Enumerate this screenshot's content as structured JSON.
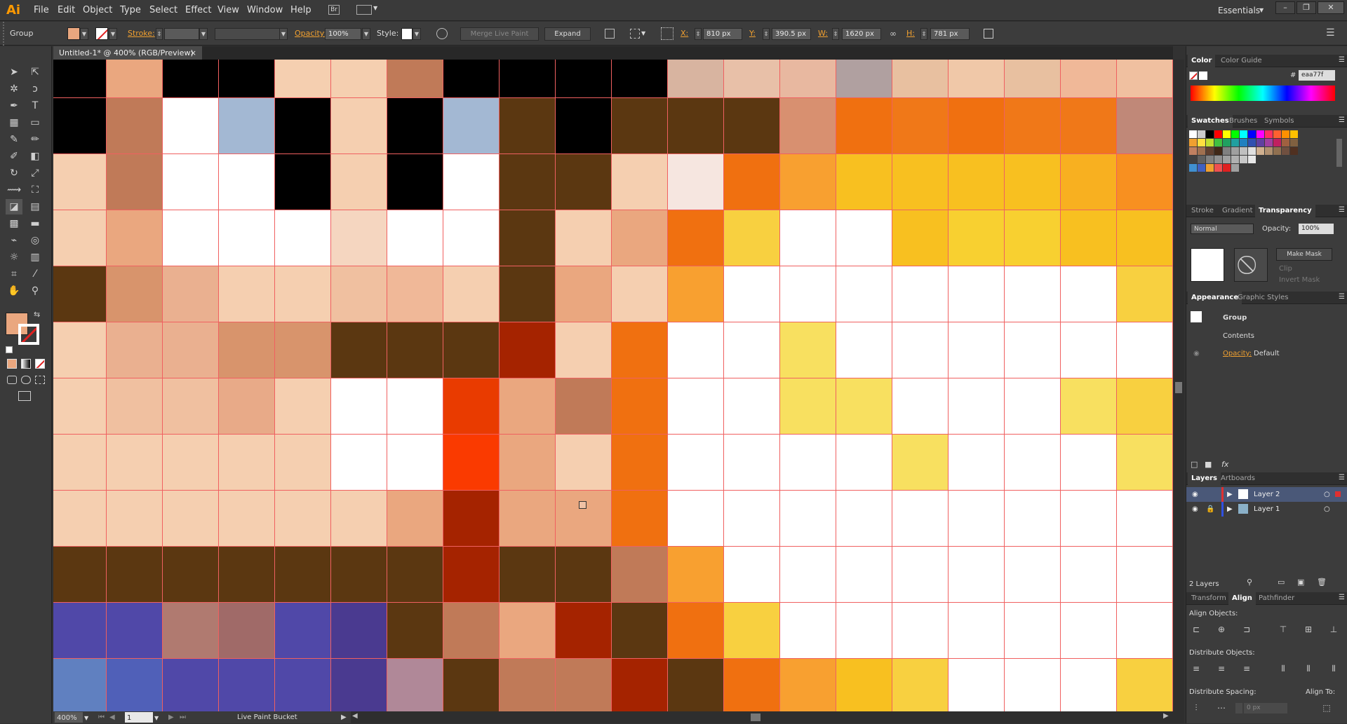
{
  "app": {
    "logo": "Ai",
    "workspace": "Essentials"
  },
  "menu": [
    "File",
    "Edit",
    "Object",
    "Type",
    "Select",
    "Effect",
    "View",
    "Window",
    "Help"
  ],
  "window_controls": [
    "–",
    "❐",
    "✕"
  ],
  "control_bar": {
    "selection_type": "Group",
    "stroke_label": "Stroke:",
    "opacity_label": "Opacity:",
    "opacity_value": "100%",
    "style_label": "Style:",
    "merge_live_paint": "Merge Live Paint",
    "expand": "Expand",
    "x_label": "X:",
    "x_value": "810 px",
    "y_label": "Y:",
    "y_value": "390.5 px",
    "w_label": "W:",
    "w_value": "1620 px",
    "h_label": "H:",
    "h_value": "781 px"
  },
  "document": {
    "tab_title": "Untitled-1* @ 400% (RGB/Preview)",
    "close": "×"
  },
  "status": {
    "zoom": "400%",
    "artboard": "1",
    "tool": "Live Paint Bucket"
  },
  "colors": {
    "fill": "#eaa77f",
    "accent_orange": "#f0a030"
  },
  "panels": {
    "color": {
      "tabs": [
        "Color",
        "Color Guide"
      ],
      "hex": "eaa77f"
    },
    "swatches": {
      "tabs": [
        "Swatches",
        "Brushes",
        "Symbols"
      ]
    },
    "transparency": {
      "tabs": [
        "Stroke",
        "Gradient",
        "Transparency"
      ],
      "blend_mode": "Normal",
      "opacity_label": "Opacity:",
      "opacity_value": "100%",
      "make_mask": "Make Mask",
      "clip": "Clip",
      "invert_mask": "Invert Mask"
    },
    "appearance": {
      "tabs": [
        "Appearance",
        "Graphic Styles"
      ],
      "group": "Group",
      "contents": "Contents",
      "opacity_label": "Opacity:",
      "opacity_value": "Default"
    },
    "layers": {
      "tabs": [
        "Layers",
        "Artboards"
      ],
      "items": [
        "Layer 2",
        "Layer 1"
      ],
      "count": "2 Layers"
    },
    "align": {
      "tabs": [
        "Transform",
        "Align",
        "Pathfinder"
      ],
      "align_objects": "Align Objects:",
      "distribute_objects": "Distribute Objects:",
      "distribute_spacing": "Distribute Spacing:",
      "align_to": "Align To:",
      "spacing_value": "0 px"
    }
  },
  "canvas_rows": [
    [
      "#000000",
      "#eaa77f",
      "#000000",
      "#000000",
      "#f5cfb0",
      "#f5cfb0",
      "#c07a58",
      "#000000",
      "#000000",
      "#000000",
      "#000000",
      "#d8b4a0",
      "#e8c0a8",
      "#e8b8a0",
      "#b0a0a0",
      "#e8c0a0",
      "#f0c8a8",
      "#e8c0a0",
      "#f0b898",
      "#f0c0a0"
    ],
    [
      "#000000",
      "#c07a58",
      "#ffffff",
      "#a3b8d3",
      "#000000",
      "#f5cfb0",
      "#000000",
      "#a3b8d3",
      "#5b3711",
      "#000000",
      "#5b3711",
      "#5b3711",
      "#5b3711",
      "#d89070",
      "#f07010",
      "#f07818",
      "#f07010",
      "#f07818",
      "#f07818",
      "#c08878"
    ],
    [
      "#f5cfb0",
      "#c07a58",
      "#ffffff",
      "#ffffff",
      "#000000",
      "#f5cfb0",
      "#000000",
      "#ffffff",
      "#5b3711",
      "#5b3711",
      "#f5cfb0",
      "#f6e6e0",
      "#f07010",
      "#f8a030",
      "#f8c020",
      "#f8c020",
      "#f8c020",
      "#f8c020",
      "#f8b020",
      "#f89020"
    ],
    [
      "#f5cfb0",
      "#eaa77f",
      "#ffffff",
      "#ffffff",
      "#ffffff",
      "#f5d6c0",
      "#ffffff",
      "#ffffff",
      "#5b3711",
      "#f5cfb0",
      "#eaa77f",
      "#f07010",
      "#f8d040",
      "#ffffff",
      "#ffffff",
      "#f8c020",
      "#f8d030",
      "#f8d030",
      "#f8c020",
      "#f8c020"
    ],
    [
      "#5b3711",
      "#d8946c",
      "#eab090",
      "#f5cfb0",
      "#f5cfb0",
      "#f0c0a0",
      "#f0b898",
      "#f5cfb0",
      "#5b3711",
      "#eaa77f",
      "#f5cfb0",
      "#f8a030",
      "#ffffff",
      "#ffffff",
      "#ffffff",
      "#ffffff",
      "#ffffff",
      "#ffffff",
      "#ffffff",
      "#f8d040"
    ],
    [
      "#f5cfb0",
      "#eab090",
      "#eab090",
      "#d8946c",
      "#d8946c",
      "#5b3711",
      "#5b3711",
      "#5b3711",
      "#a52300",
      "#f5cfb0",
      "#f07010",
      "#ffffff",
      "#ffffff",
      "#f8e060",
      "#ffffff",
      "#ffffff",
      "#ffffff",
      "#ffffff",
      "#ffffff",
      "#ffffff"
    ],
    [
      "#f5cfb0",
      "#f0c0a0",
      "#f0c0a0",
      "#e8aa88",
      "#f5cfb0",
      "#ffffff",
      "#ffffff",
      "#e93b00",
      "#eaa77f",
      "#c07a58",
      "#f07010",
      "#ffffff",
      "#ffffff",
      "#f8e060",
      "#f8e060",
      "#ffffff",
      "#ffffff",
      "#ffffff",
      "#f8e060",
      "#f8d040"
    ],
    [
      "#f5cfb0",
      "#f5cfb0",
      "#f5cfb0",
      "#f5cfb0",
      "#f5cfb0",
      "#ffffff",
      "#ffffff",
      "#fa3a00",
      "#eaa77f",
      "#f5cfb0",
      "#f07010",
      "#ffffff",
      "#ffffff",
      "#ffffff",
      "#ffffff",
      "#f8e060",
      "#ffffff",
      "#ffffff",
      "#ffffff",
      "#f8e060"
    ],
    [
      "#f5cfb0",
      "#f5cfb0",
      "#f5cfb0",
      "#f5cfb0",
      "#f5cfb0",
      "#f5cfb0",
      "#eaa77f",
      "#a52300",
      "#eaa77f",
      "#eaa77f",
      "#f07010",
      "#ffffff",
      "#ffffff",
      "#ffffff",
      "#ffffff",
      "#ffffff",
      "#ffffff",
      "#ffffff",
      "#ffffff",
      "#ffffff"
    ],
    [
      "#5b3711",
      "#5b3711",
      "#5b3711",
      "#5b3711",
      "#5b3711",
      "#5b3711",
      "#5b3711",
      "#a52300",
      "#5b3711",
      "#5b3711",
      "#c07a58",
      "#f8a030",
      "#ffffff",
      "#ffffff",
      "#ffffff",
      "#ffffff",
      "#ffffff",
      "#ffffff",
      "#ffffff",
      "#ffffff"
    ],
    [
      "#5048a8",
      "#5048a8",
      "#b07a70",
      "#a06a68",
      "#5048a8",
      "#4a3a90",
      "#5b3711",
      "#c07a58",
      "#eaa77f",
      "#a52300",
      "#5b3711",
      "#f07010",
      "#f8d040",
      "#ffffff",
      "#ffffff",
      "#ffffff",
      "#ffffff",
      "#ffffff",
      "#ffffff",
      "#ffffff"
    ],
    [
      "#6080c0",
      "#5060b8",
      "#5048a8",
      "#5048a8",
      "#5048a8",
      "#4a3a90",
      "#b08898",
      "#5b3711",
      "#c07a58",
      "#c07a58",
      "#a52300",
      "#5b3711",
      "#f07010",
      "#f8a030",
      "#f8c020",
      "#f8d040",
      "#ffffff",
      "#ffffff",
      "#ffffff",
      "#f8d040"
    ]
  ]
}
